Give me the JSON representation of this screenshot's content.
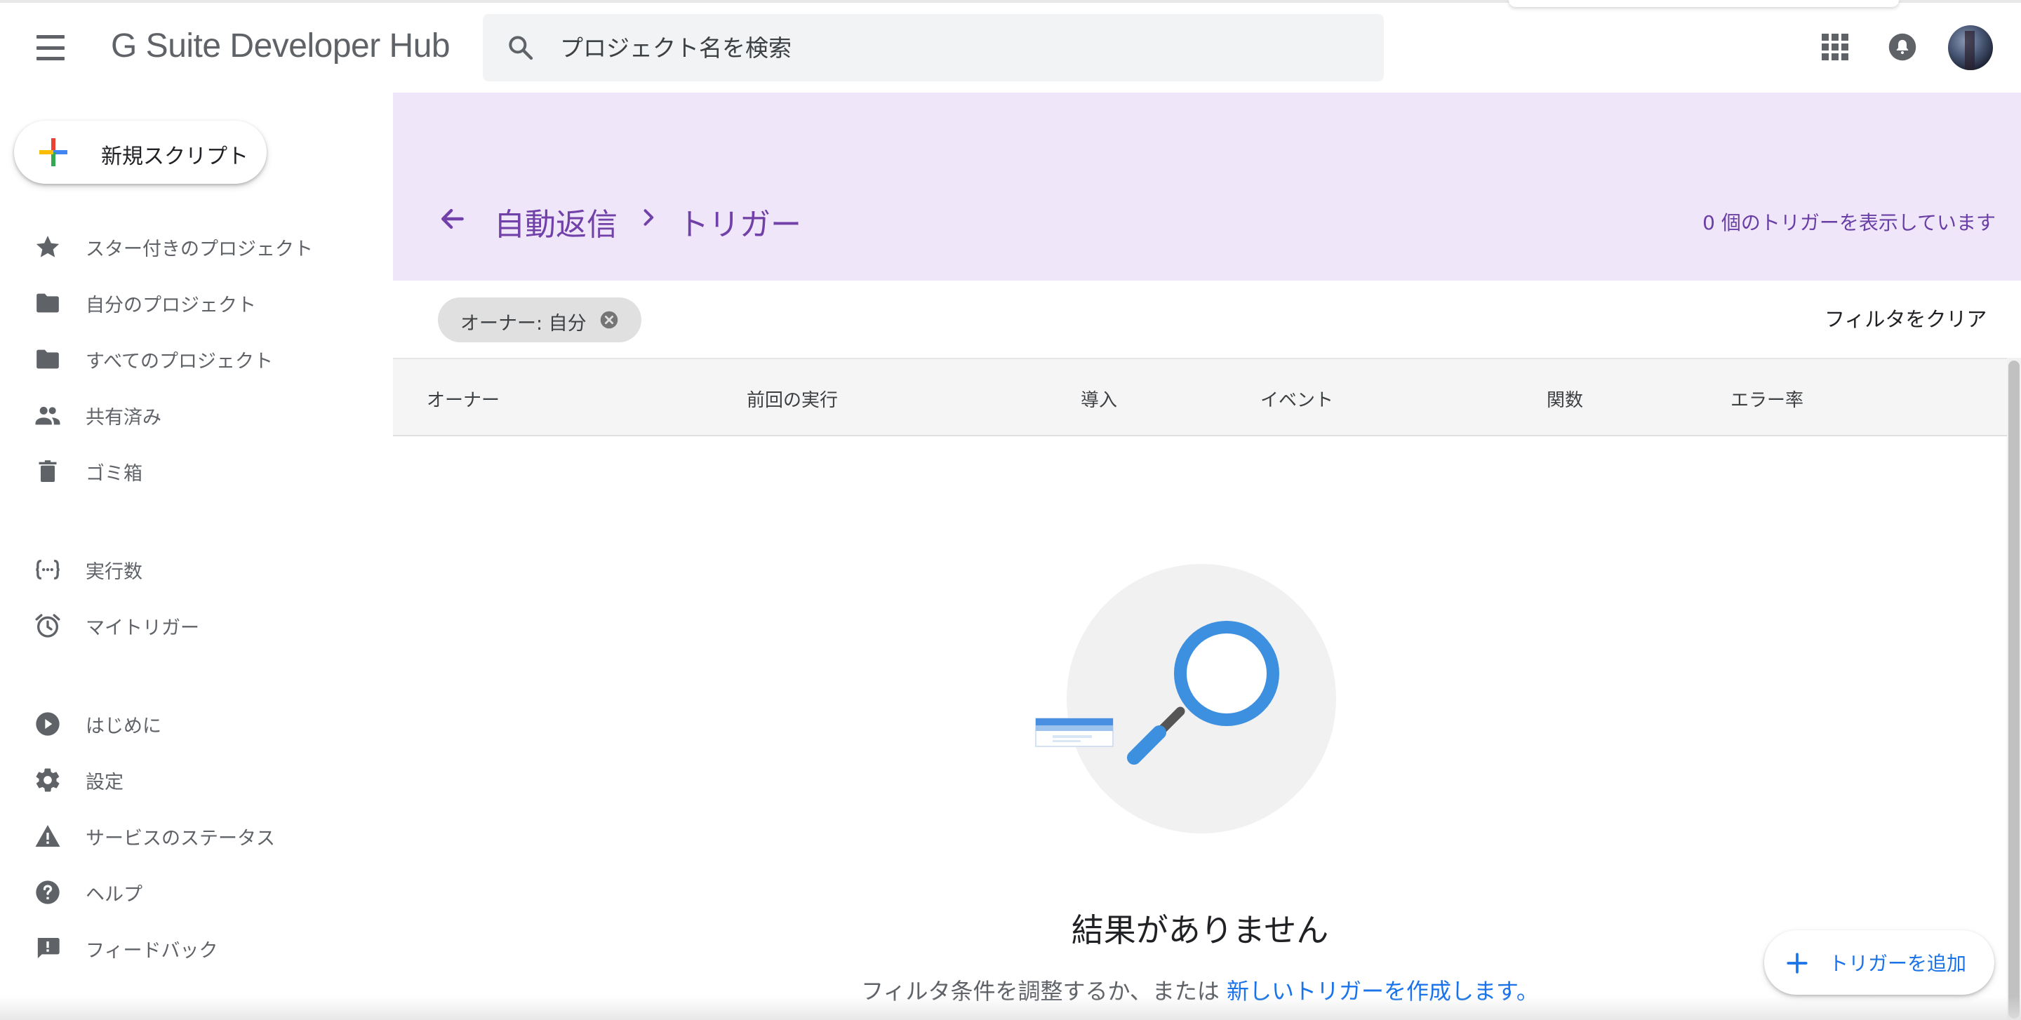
{
  "app": {
    "brand": "G Suite Developer Hub"
  },
  "search": {
    "placeholder": "プロジェクト名を検索"
  },
  "sidebar": {
    "new_script_label": "新規スクリプト",
    "items": [
      {
        "label": "スター付きのプロジェクト",
        "icon": "star-icon"
      },
      {
        "label": "自分のプロジェクト",
        "icon": "folder-icon"
      },
      {
        "label": "すべてのプロジェクト",
        "icon": "folder-icon"
      },
      {
        "label": "共有済み",
        "icon": "people-icon"
      },
      {
        "label": "ゴミ箱",
        "icon": "trash-icon"
      },
      {
        "label": "実行数",
        "icon": "executions-icon"
      },
      {
        "label": "マイトリガー",
        "icon": "alarm-icon"
      },
      {
        "label": "はじめに",
        "icon": "play-circle-icon"
      },
      {
        "label": "設定",
        "icon": "gear-icon"
      },
      {
        "label": "サービスのステータス",
        "icon": "warning-icon"
      },
      {
        "label": "ヘルプ",
        "icon": "help-icon"
      },
      {
        "label": "フィードバック",
        "icon": "feedback-icon"
      }
    ]
  },
  "header": {
    "project_name": "自動返信",
    "page_title": "トリガー",
    "trigger_count_text": "0 個のトリガーを表示しています"
  },
  "filters": {
    "chip_label": "オーナー: 自分",
    "clear_label": "フィルタをクリア"
  },
  "table": {
    "columns": [
      "オーナー",
      "前回の実行",
      "導入",
      "イベント",
      "関数",
      "エラー率"
    ]
  },
  "empty_state": {
    "title": "結果がありません",
    "subtitle_prefix": "フィルタ条件を調整するか、または ",
    "subtitle_link": "新しいトリガーを作成します。"
  },
  "fab": {
    "label": "トリガーを追加"
  },
  "colors": {
    "accent_purple": "#7140a8",
    "header_band": "#efe7f9",
    "link_blue": "#1a73e8",
    "magnifier_blue": "#3d8fe0"
  }
}
